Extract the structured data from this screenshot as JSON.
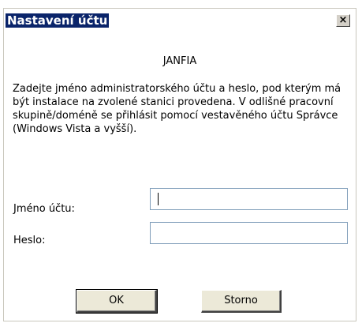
{
  "window": {
    "title": "Nastavení účtu",
    "close_symbol": "×"
  },
  "content": {
    "company": "JANFIA",
    "instructions": "Zadejte jméno administratorského účtu a heslo, pod kterým má být instalace na zvolené stanici provedena. V odlišné pracovní skupině/doméně se přihlásit pomocí vestavěného účtu Správce (Windows Vista a vyšší).",
    "username_label": "Jméno účtu:",
    "username_value": "",
    "password_label": "Heslo:",
    "password_value": ""
  },
  "buttons": {
    "ok": "OK",
    "cancel": "Storno"
  },
  "colors": {
    "title_bg": "#0a246a",
    "title_fg": "#ffffff",
    "button_bg": "#ece9d8"
  },
  "icons": {
    "close": "close-icon"
  }
}
